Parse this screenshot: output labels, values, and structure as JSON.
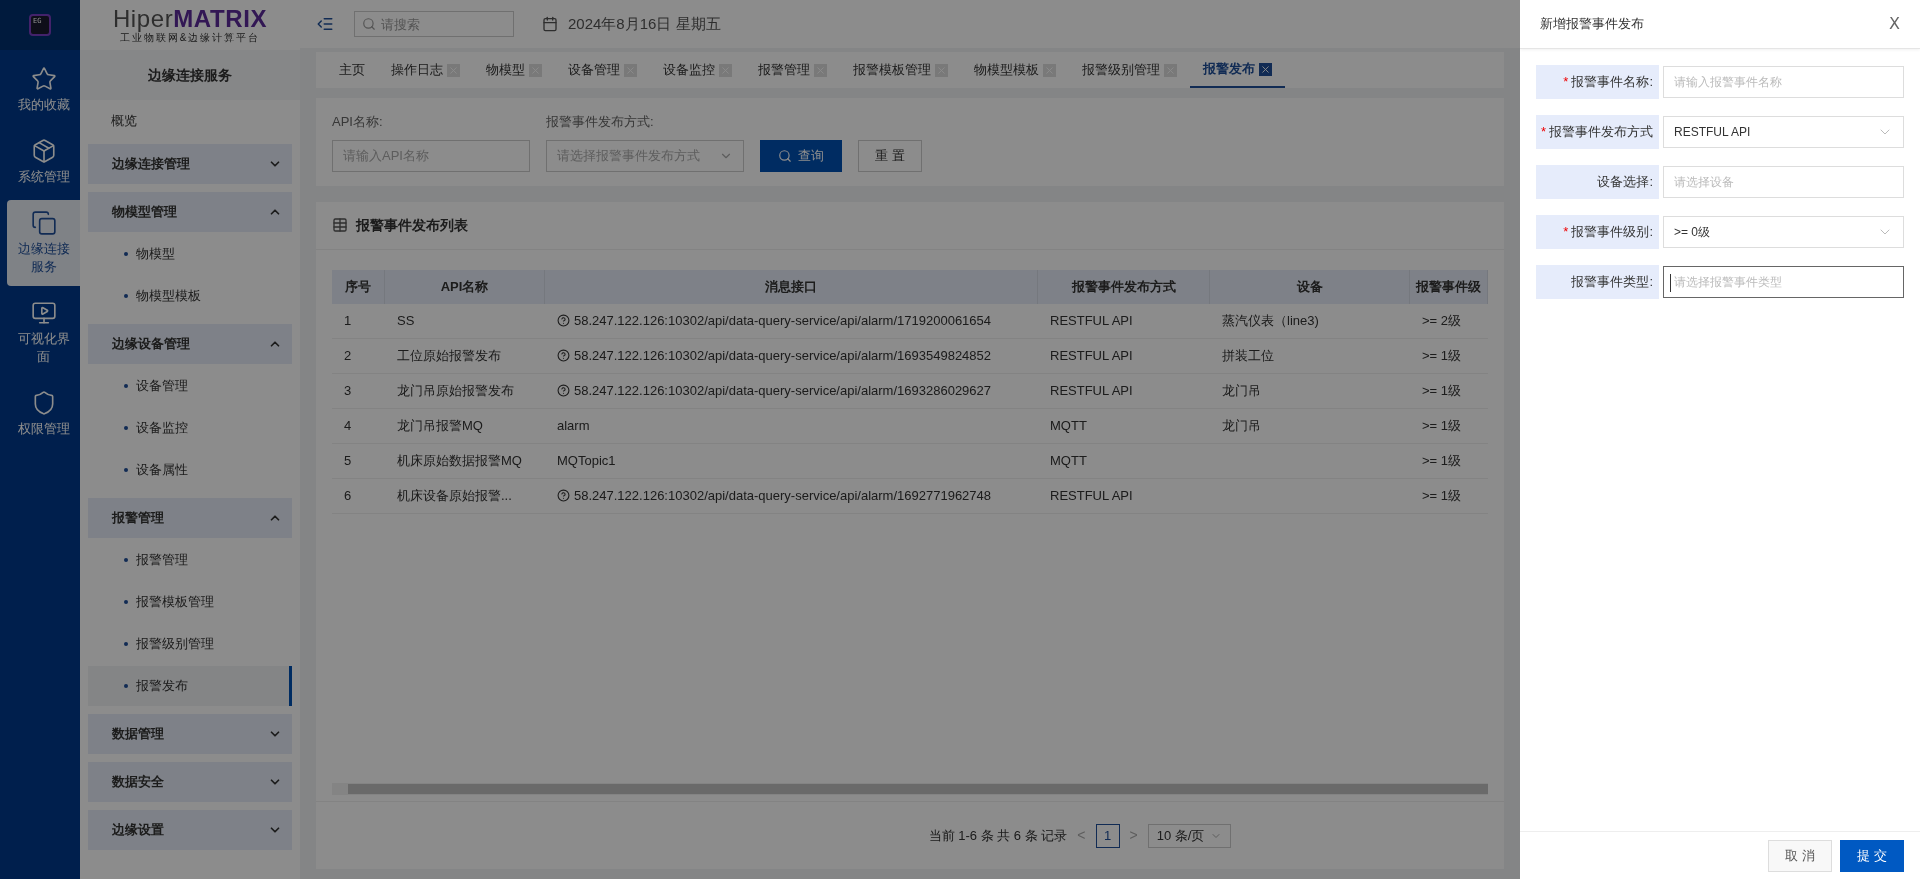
{
  "rail": {
    "logo_text": "EG",
    "items": [
      {
        "label": "我的收藏",
        "selected": false
      },
      {
        "label": "系统管理",
        "selected": false
      },
      {
        "label": "边缘连接服务",
        "selected": true
      },
      {
        "label": "可视化界面",
        "selected": false
      },
      {
        "label": "权限管理",
        "selected": false
      }
    ]
  },
  "brand": {
    "name_start": "Hiper",
    "name_end": "MATRIX",
    "subtitle": "工业物联网&边缘计算平台"
  },
  "sidebar": {
    "title": "边缘连接服务",
    "items": [
      {
        "kind": "link",
        "label": "概览"
      },
      {
        "kind": "group",
        "label": "边缘连接管理",
        "expanded": false
      },
      {
        "kind": "group",
        "label": "物模型管理",
        "expanded": true,
        "children": [
          {
            "label": "物模型",
            "selected": false
          },
          {
            "label": "物模型模板",
            "selected": false
          }
        ]
      },
      {
        "kind": "group",
        "label": "边缘设备管理",
        "expanded": true,
        "children": [
          {
            "label": "设备管理",
            "selected": false
          },
          {
            "label": "设备监控",
            "selected": false
          },
          {
            "label": "设备属性",
            "selected": false
          }
        ]
      },
      {
        "kind": "group",
        "label": "报警管理",
        "expanded": true,
        "children": [
          {
            "label": "报警管理",
            "selected": false
          },
          {
            "label": "报警模板管理",
            "selected": false
          },
          {
            "label": "报警级别管理",
            "selected": false
          },
          {
            "label": "报警发布",
            "selected": true
          }
        ]
      },
      {
        "kind": "group",
        "label": "数据管理",
        "expanded": false
      },
      {
        "kind": "group",
        "label": "数据安全",
        "expanded": false
      },
      {
        "kind": "group",
        "label": "边缘设置",
        "expanded": false
      }
    ]
  },
  "topbar": {
    "search": {
      "placeholder": "请搜索"
    },
    "date": "2024年8月16日 星期五"
  },
  "tabs": [
    {
      "label": "主页",
      "selected": false,
      "closable": false
    },
    {
      "label": "操作日志",
      "selected": false,
      "closable": true
    },
    {
      "label": "物模型",
      "selected": false,
      "closable": true
    },
    {
      "label": "设备管理",
      "selected": false,
      "closable": true
    },
    {
      "label": "设备监控",
      "selected": false,
      "closable": true
    },
    {
      "label": "报警管理",
      "selected": false,
      "closable": true
    },
    {
      "label": "报警模板管理",
      "selected": false,
      "closable": true
    },
    {
      "label": "物模型模板",
      "selected": false,
      "closable": true
    },
    {
      "label": "报警级别管理",
      "selected": false,
      "closable": true
    },
    {
      "label": "报警发布",
      "selected": true,
      "closable": true
    }
  ],
  "filters": {
    "api_name": {
      "label": "API名称:",
      "placeholder": "请输入API名称"
    },
    "method": {
      "label": "报警事件发布方式:",
      "placeholder": "请选择报警事件发布方式"
    },
    "search_button": "查询",
    "reset_button": "重 置"
  },
  "table": {
    "title": "报警事件发布列表",
    "columns": [
      "序号",
      "API名称",
      "消息接口",
      "报警事件发布方式",
      "设备",
      "报警事件级"
    ],
    "rows": [
      {
        "cells": [
          "1",
          "SS",
          "58.247.122.126:10302/api/data-query-service/api/alarm/1719200061654",
          "RESTFUL API",
          "蒸汽仪表（line3)",
          ">= 2级"
        ],
        "interface_icon": true
      },
      {
        "cells": [
          "2",
          "工位原始报警发布",
          "58.247.122.126:10302/api/data-query-service/api/alarm/1693549824852",
          "RESTFUL API",
          "拼装工位",
          ">= 1级"
        ],
        "interface_icon": true
      },
      {
        "cells": [
          "3",
          "龙门吊原始报警发布",
          "58.247.122.126:10302/api/data-query-service/api/alarm/1693286029627",
          "RESTFUL API",
          "龙门吊",
          ">= 1级"
        ],
        "interface_icon": true
      },
      {
        "cells": [
          "4",
          "龙门吊报警MQ",
          "alarm",
          "MQTT",
          "龙门吊",
          ">= 1级"
        ],
        "interface_icon": false
      },
      {
        "cells": [
          "5",
          "机床原始数据报警MQ",
          "MQTopic1",
          "MQTT",
          "",
          ">= 1级"
        ],
        "interface_icon": false
      },
      {
        "cells": [
          "6",
          "机床设备原始报警...",
          "58.247.122.126:10302/api/data-query-service/api/alarm/1692771962748",
          "RESTFUL API",
          "",
          ">= 1级"
        ],
        "interface_icon": true
      }
    ]
  },
  "pagination": {
    "summary": "当前 1-6 条 共 6 条 记录",
    "prev": "<",
    "pages": [
      {
        "label": "1",
        "selected": true
      }
    ],
    "next": ">",
    "page_size": "10 条/页"
  },
  "drawer": {
    "title": "新增报警事件发布",
    "close": "X",
    "required_mark": "*",
    "fields": [
      {
        "kind": "input",
        "label": "报警事件名称:",
        "required": true,
        "placeholder": "请输入报警事件名称",
        "focused": false
      },
      {
        "kind": "select",
        "label": "报警事件发布方式",
        "required": true,
        "value": "RESTFUL API",
        "focused": false
      },
      {
        "kind": "input",
        "label": "设备选择:",
        "required": false,
        "placeholder": "请选择设备",
        "focused": false
      },
      {
        "kind": "select",
        "label": "报警事件级别:",
        "required": true,
        "value": ">= 0级",
        "focused": false
      },
      {
        "kind": "input",
        "label": "报警事件类型:",
        "required": false,
        "placeholder": "请选择报警事件类型",
        "focused": true
      }
    ],
    "cancel_button": "取 消",
    "submit_button": "提 交"
  }
}
